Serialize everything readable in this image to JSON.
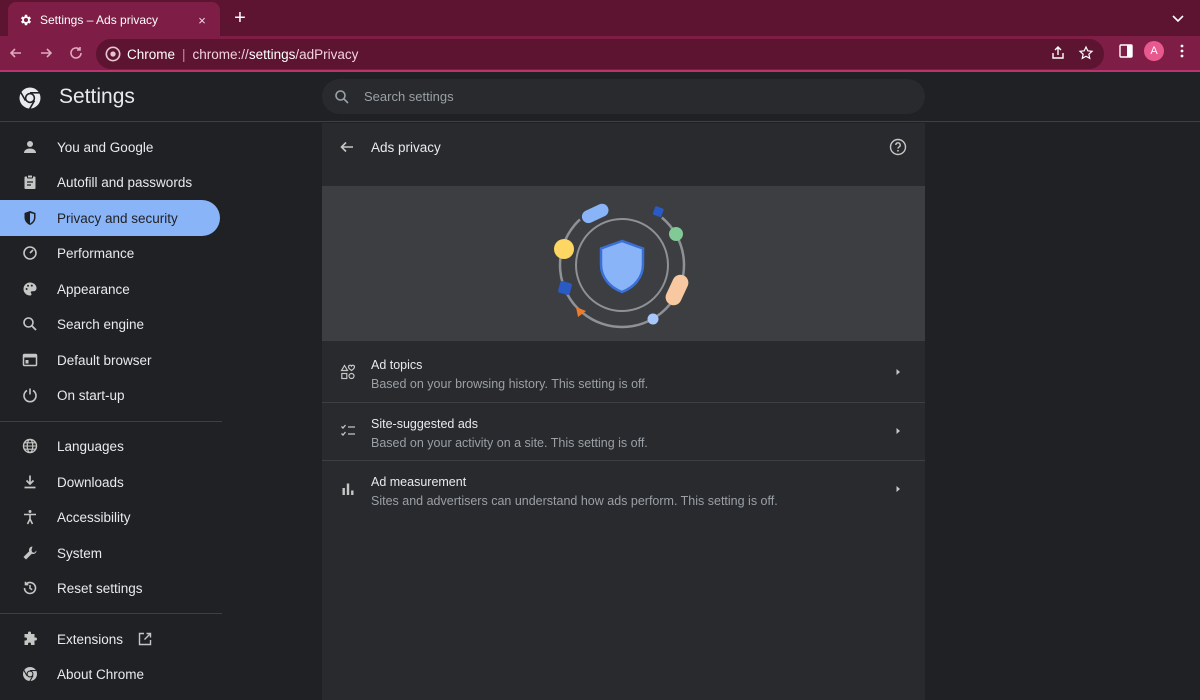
{
  "tab": {
    "title": "Settings – Ads privacy",
    "close_label": "×",
    "new_tab_label": "+"
  },
  "omnibox": {
    "site_label": "Chrome",
    "separator": "|",
    "url_prefix": "chrome://",
    "url_host": "settings",
    "url_path": "/adPrivacy"
  },
  "profile": {
    "initial": "A",
    "color": "#e85a8f"
  },
  "header": {
    "title": "Settings",
    "search_placeholder": "Search settings"
  },
  "colors": {
    "tabstrip": "#5c1430",
    "toolbar": "#7e1d45",
    "accent": "#8ab4f8",
    "background": "#202124",
    "card": "#292a2d"
  },
  "sidebar": {
    "items": [
      {
        "label": "You and Google",
        "icon": "person-icon"
      },
      {
        "label": "Autofill and passwords",
        "icon": "clipboard-icon"
      },
      {
        "label": "Privacy and security",
        "icon": "shield-icon",
        "active": true
      },
      {
        "label": "Performance",
        "icon": "speedometer-icon"
      },
      {
        "label": "Appearance",
        "icon": "palette-icon"
      },
      {
        "label": "Search engine",
        "icon": "search-icon"
      },
      {
        "label": "Default browser",
        "icon": "browser-window-icon"
      },
      {
        "label": "On start-up",
        "icon": "power-icon"
      },
      {
        "label": "Languages",
        "icon": "globe-icon"
      },
      {
        "label": "Downloads",
        "icon": "download-icon"
      },
      {
        "label": "Accessibility",
        "icon": "accessibility-icon"
      },
      {
        "label": "System",
        "icon": "wrench-icon"
      },
      {
        "label": "Reset settings",
        "icon": "history-icon"
      },
      {
        "label": "Extensions",
        "icon": "puzzle-icon"
      },
      {
        "label": "About Chrome",
        "icon": "chrome-icon"
      }
    ]
  },
  "content": {
    "title": "Ads privacy",
    "rows": [
      {
        "title": "Ad topics",
        "subtitle": "Based on your browsing history. This setting is off.",
        "icon": "topics-icon"
      },
      {
        "title": "Site-suggested ads",
        "subtitle": "Based on your activity on a site. This setting is off.",
        "icon": "checklist-icon"
      },
      {
        "title": "Ad measurement",
        "subtitle": "Sites and advertisers can understand how ads perform. This setting is off.",
        "icon": "bar-chart-icon"
      }
    ]
  }
}
